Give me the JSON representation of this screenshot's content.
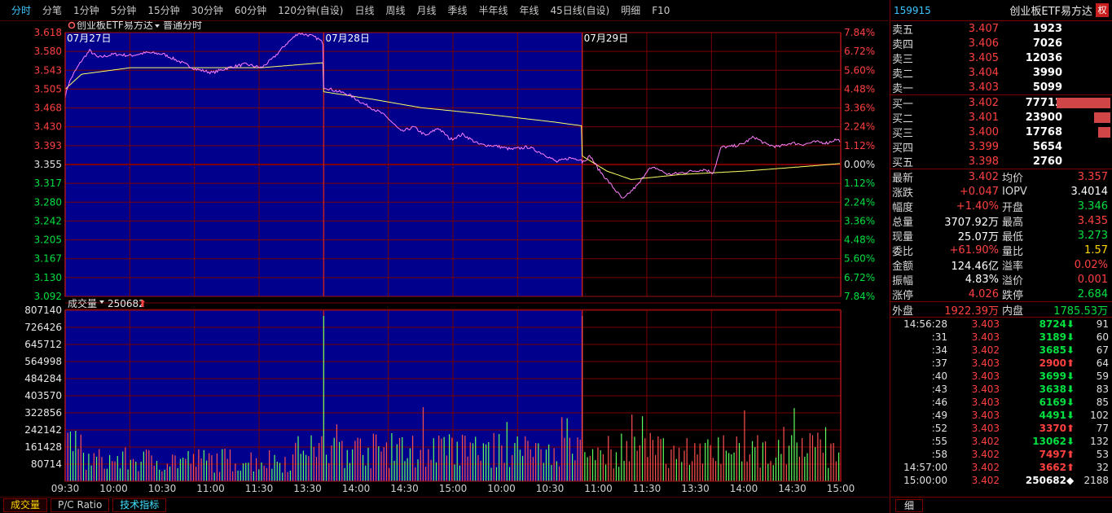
{
  "toptabs": [
    "分时",
    "分笔",
    "1分钟",
    "5分钟",
    "15分钟",
    "30分钟",
    "60分钟",
    "120分钟(自设)",
    "日线",
    "周线",
    "月线",
    "季线",
    "半年线",
    "年线",
    "45日线(自设)",
    "明细",
    "F10"
  ],
  "chart_data": {
    "type": "line",
    "title": "创业板ETF易方达",
    "mode_label": "普通分时",
    "date_labels": [
      "07月27日",
      "07月28日",
      "07月29日"
    ],
    "prev_close": 3.355,
    "price_ticks": [
      "3.618",
      "3.580",
      "3.543",
      "3.505",
      "3.468",
      "3.430",
      "3.393",
      "3.355",
      "3.317",
      "3.280",
      "3.242",
      "3.205",
      "3.167",
      "3.130",
      "3.092"
    ],
    "pct_ticks": [
      "7.84%",
      "6.72%",
      "5.60%",
      "4.48%",
      "3.36%",
      "2.24%",
      "1.12%",
      "0.00%",
      "1.12%",
      "2.24%",
      "3.36%",
      "4.48%",
      "5.60%",
      "6.72%",
      "7.84%"
    ],
    "price_range": [
      3.092,
      3.618
    ],
    "volume_label": "成交量",
    "volume_value": "250682",
    "volume_ticks": [
      "807140",
      "726426",
      "645712",
      "564998",
      "484284",
      "403570",
      "322856",
      "242142",
      "161428",
      "80714"
    ],
    "volume_range": [
      0,
      807140
    ],
    "time_labels": [
      "09:30",
      "10:00",
      "10:30",
      "11:00",
      "11:30",
      "13:30",
      "14:00",
      "14:30",
      "15:00",
      "10:00",
      "10:30",
      "11:00",
      "11:30",
      "13:30",
      "14:00",
      "14:30",
      "15:00"
    ],
    "price_keypoints": [
      [
        [
          0,
          3.49
        ],
        [
          4,
          3.515
        ],
        [
          10,
          3.535
        ],
        [
          20,
          3.562
        ],
        [
          30,
          3.582
        ],
        [
          40,
          3.568
        ],
        [
          60,
          3.575
        ],
        [
          80,
          3.572
        ],
        [
          100,
          3.578
        ],
        [
          120,
          3.575
        ],
        [
          140,
          3.56
        ],
        [
          160,
          3.545
        ],
        [
          180,
          3.538
        ],
        [
          200,
          3.548
        ],
        [
          220,
          3.555
        ],
        [
          240,
          3.548
        ],
        [
          255,
          3.568
        ],
        [
          270,
          3.595
        ],
        [
          285,
          3.617
        ],
        [
          300,
          3.612
        ],
        [
          310,
          3.605
        ],
        [
          316,
          3.595
        ]
      ],
      [
        [
          0,
          3.51
        ],
        [
          8,
          3.505
        ],
        [
          30,
          3.495
        ],
        [
          50,
          3.475
        ],
        [
          70,
          3.458
        ],
        [
          80,
          3.445
        ],
        [
          95,
          3.42
        ],
        [
          110,
          3.43
        ],
        [
          125,
          3.412
        ],
        [
          140,
          3.428
        ],
        [
          155,
          3.405
        ],
        [
          170,
          3.415
        ],
        [
          190,
          3.395
        ],
        [
          210,
          3.392
        ],
        [
          230,
          3.385
        ],
        [
          250,
          3.39
        ],
        [
          270,
          3.375
        ],
        [
          285,
          3.36
        ],
        [
          300,
          3.368
        ],
        [
          316,
          3.365
        ]
      ],
      [
        [
          0,
          3.36
        ],
        [
          10,
          3.372
        ],
        [
          20,
          3.345
        ],
        [
          30,
          3.325
        ],
        [
          40,
          3.305
        ],
        [
          50,
          3.285
        ],
        [
          60,
          3.302
        ],
        [
          70,
          3.318
        ],
        [
          80,
          3.345
        ],
        [
          90,
          3.348
        ],
        [
          105,
          3.335
        ],
        [
          120,
          3.338
        ],
        [
          135,
          3.342
        ],
        [
          150,
          3.345
        ],
        [
          160,
          3.338
        ],
        [
          170,
          3.39
        ],
        [
          180,
          3.39
        ],
        [
          195,
          3.395
        ],
        [
          210,
          3.41
        ],
        [
          225,
          3.395
        ],
        [
          240,
          3.39
        ],
        [
          255,
          3.398
        ],
        [
          270,
          3.395
        ],
        [
          285,
          3.4
        ],
        [
          300,
          3.398
        ],
        [
          310,
          3.405
        ],
        [
          316,
          3.402
        ]
      ]
    ],
    "avg_keypoints": [
      [
        [
          0,
          3.505
        ],
        [
          20,
          3.535
        ],
        [
          80,
          3.548
        ],
        [
          160,
          3.548
        ],
        [
          240,
          3.548
        ],
        [
          316,
          3.558
        ]
      ],
      [
        [
          0,
          3.5
        ],
        [
          60,
          3.485
        ],
        [
          120,
          3.468
        ],
        [
          200,
          3.455
        ],
        [
          280,
          3.44
        ],
        [
          316,
          3.432
        ]
      ],
      [
        [
          0,
          3.372
        ],
        [
          30,
          3.342
        ],
        [
          60,
          3.325
        ],
        [
          120,
          3.335
        ],
        [
          200,
          3.342
        ],
        [
          280,
          3.352
        ],
        [
          316,
          3.357
        ]
      ]
    ]
  },
  "right_panel": {
    "code": "159915",
    "name": "创业板ETF易方达",
    "quan": "权",
    "asks": [
      {
        "label": "卖五",
        "price": "3.407",
        "vol": "1923",
        "bar": 0
      },
      {
        "label": "卖四",
        "price": "3.406",
        "vol": "7026",
        "bar": 0
      },
      {
        "label": "卖三",
        "price": "3.405",
        "vol": "12036",
        "bar": 0
      },
      {
        "label": "卖二",
        "price": "3.404",
        "vol": "3990",
        "bar": 0
      },
      {
        "label": "卖一",
        "price": "3.403",
        "vol": "5099",
        "bar": 0
      }
    ],
    "bids": [
      {
        "label": "买一",
        "price": "3.402",
        "vol": "77712",
        "bar": 66
      },
      {
        "label": "买二",
        "price": "3.401",
        "vol": "23900",
        "bar": 20
      },
      {
        "label": "买三",
        "price": "3.400",
        "vol": "17768",
        "bar": 15
      },
      {
        "label": "买四",
        "price": "3.399",
        "vol": "5654",
        "bar": 0
      },
      {
        "label": "买五",
        "price": "3.398",
        "vol": "2760",
        "bar": 0
      }
    ],
    "stats": [
      {
        "l1": "最新",
        "v1": "3.402",
        "c1": "red",
        "l2": "均价",
        "v2": "3.357",
        "c2": "red"
      },
      {
        "l1": "涨跌",
        "v1": "+0.047",
        "c1": "red",
        "l2": "IOPV",
        "v2": "3.4014",
        "c2": "white"
      },
      {
        "l1": "幅度",
        "v1": "+1.40%",
        "c1": "red",
        "l2": "开盘",
        "v2": "3.346",
        "c2": "green"
      },
      {
        "l1": "总量",
        "v1": "3707.92万",
        "c1": "white",
        "l2": "最高",
        "v2": "3.435",
        "c2": "red"
      },
      {
        "l1": "现量",
        "v1": "25.07万",
        "c1": "white",
        "l2": "最低",
        "v2": "3.273",
        "c2": "green"
      },
      {
        "l1": "委比",
        "v1": "+61.90%",
        "c1": "red",
        "l2": "量比",
        "v2": "1.57",
        "c2": "yellow"
      },
      {
        "l1": "金额",
        "v1": "124.46亿",
        "c1": "white",
        "l2": "溢率",
        "v2": "0.02%",
        "c2": "red"
      },
      {
        "l1": "振幅",
        "v1": "4.83%",
        "c1": "white",
        "l2": "溢价",
        "v2": "0.001",
        "c2": "red"
      },
      {
        "l1": "涨停",
        "v1": "4.026",
        "c1": "red",
        "l2": "跌停",
        "v2": "2.684",
        "c2": "green"
      }
    ],
    "outer_label": "外盘",
    "outer_val": "1922.39万",
    "inner_label": "内盘",
    "inner_val": "1785.53万",
    "ticks": [
      {
        "t": "14:56:28",
        "p": "3.403",
        "pc": "red",
        "v": "8724",
        "vc": "green",
        "a": "⬇",
        "n": "91"
      },
      {
        "t": ":31",
        "p": "3.403",
        "pc": "red",
        "v": "3189",
        "vc": "green",
        "a": "⬇",
        "n": "60"
      },
      {
        "t": ":34",
        "p": "3.402",
        "pc": "red",
        "v": "3685",
        "vc": "green",
        "a": "⬇",
        "n": "67"
      },
      {
        "t": ":37",
        "p": "3.403",
        "pc": "red",
        "v": "2900",
        "vc": "red",
        "a": "⬆",
        "n": "64"
      },
      {
        "t": ":40",
        "p": "3.403",
        "pc": "red",
        "v": "3699",
        "vc": "green",
        "a": "⬇",
        "n": "59"
      },
      {
        "t": ":43",
        "p": "3.403",
        "pc": "red",
        "v": "3638",
        "vc": "green",
        "a": "⬇",
        "n": "83"
      },
      {
        "t": ":46",
        "p": "3.403",
        "pc": "red",
        "v": "6169",
        "vc": "green",
        "a": "⬇",
        "n": "85"
      },
      {
        "t": ":49",
        "p": "3.403",
        "pc": "red",
        "v": "4491",
        "vc": "green",
        "a": "⬇",
        "n": "102"
      },
      {
        "t": ":52",
        "p": "3.403",
        "pc": "red",
        "v": "3370",
        "vc": "red",
        "a": "⬆",
        "n": "77"
      },
      {
        "t": ":55",
        "p": "3.402",
        "pc": "red",
        "v": "13062",
        "vc": "green",
        "a": "⬇",
        "n": "132"
      },
      {
        "t": ":58",
        "p": "3.402",
        "pc": "red",
        "v": "7497",
        "vc": "red",
        "a": "⬆",
        "n": "53"
      },
      {
        "t": "14:57:00",
        "p": "3.402",
        "pc": "red",
        "v": "3662",
        "vc": "red",
        "a": "⬆",
        "n": "32"
      },
      {
        "t": "15:00:00",
        "p": "3.402",
        "pc": "red",
        "v": "250682",
        "vc": "white",
        "a": "◆",
        "n": "2188"
      }
    ],
    "xi": "细"
  },
  "bottomtabs": [
    "成交量",
    "P/C Ratio",
    "技术指标"
  ],
  "colors": {
    "up": "#ff4040",
    "down": "#00e040",
    "bg_blue": "#00008c",
    "grid": "#7a0000",
    "price_line": "#ff80ff",
    "avg_line": "#ffff66"
  }
}
